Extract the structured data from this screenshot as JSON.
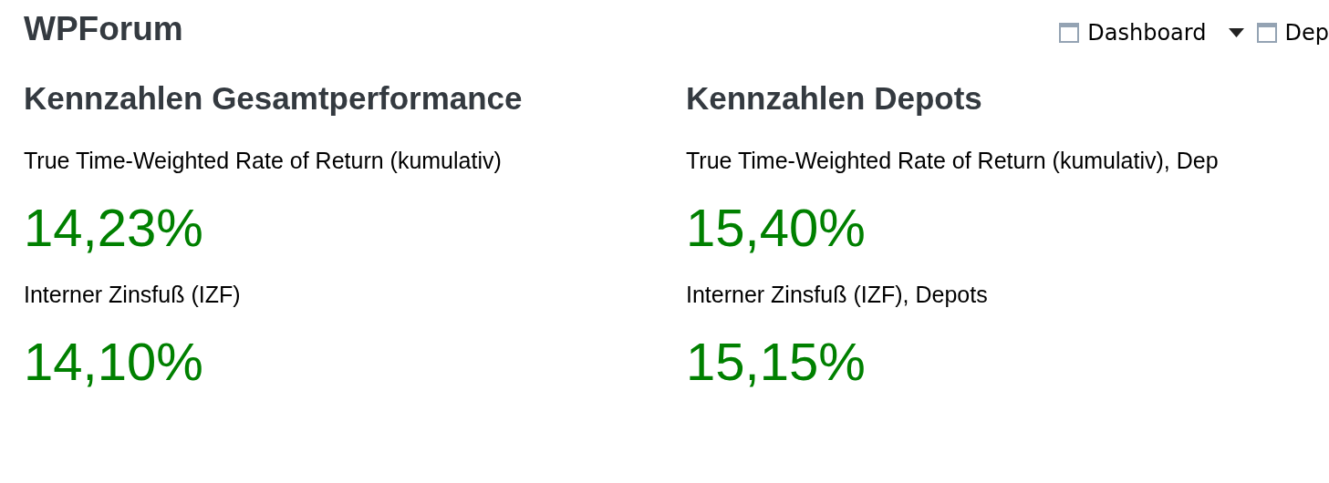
{
  "site_title": "WPForum",
  "nav": [
    {
      "kind": "page",
      "label": "Dashboard"
    },
    {
      "kind": "dropdown"
    },
    {
      "kind": "page",
      "label": "Dep"
    }
  ],
  "sections": [
    {
      "heading": "Kennzahlen Gesamtperformance",
      "metrics": [
        {
          "label": "True Time-Weighted Rate of Return (kumulativ)",
          "value": "14,23%"
        },
        {
          "label": "Interner Zinsfuß (IZF)",
          "value": "14,10%"
        }
      ]
    },
    {
      "heading": "Kennzahlen Depots",
      "metrics": [
        {
          "label": "True Time-Weighted Rate of Return (kumulativ), Dep",
          "value": "15,40%"
        },
        {
          "label": "Interner Zinsfuß (IZF), Depots",
          "value": "15,15%"
        }
      ]
    }
  ]
}
